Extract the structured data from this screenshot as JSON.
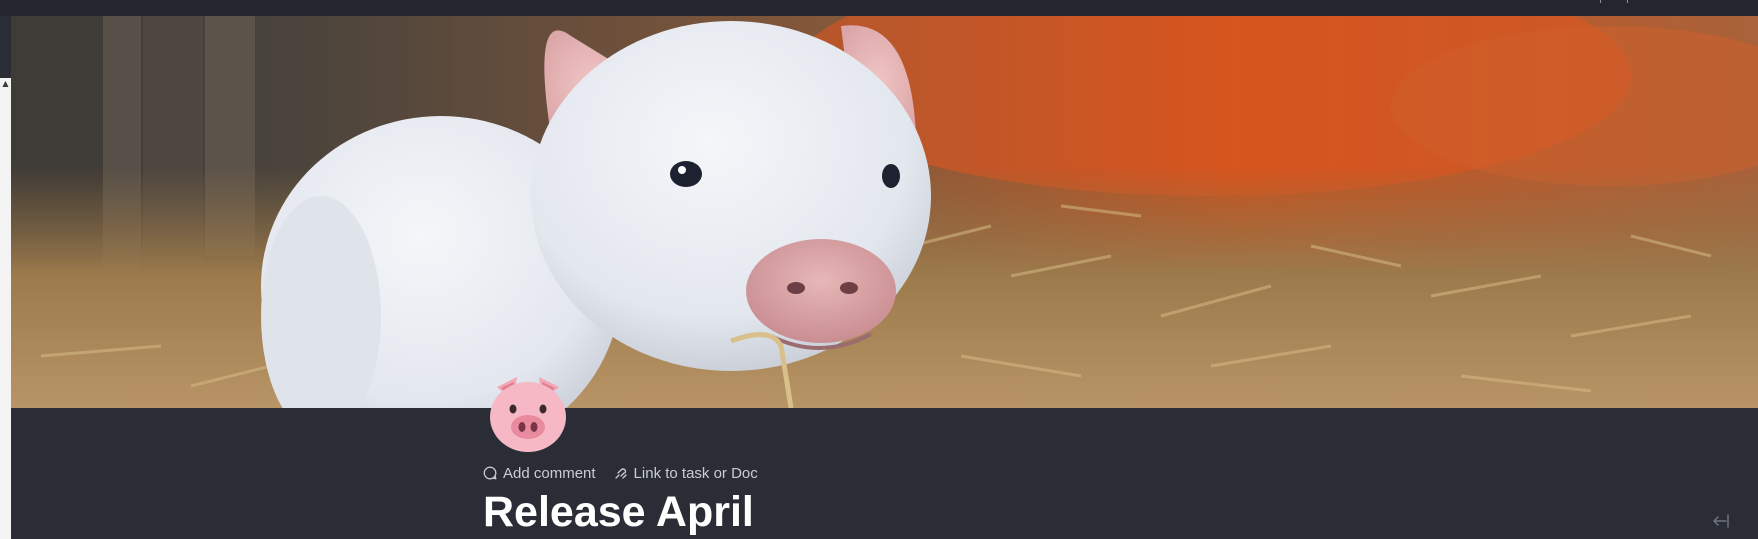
{
  "cover": {
    "image": "pig-eating-straw-photo",
    "colors": {
      "straw": "#b08a52",
      "pig": "#eceff3",
      "barn_wall": "#4b463f",
      "warm_light": "#d9532a"
    }
  },
  "doc": {
    "icon": "pig-face-emoji",
    "title": "Release April"
  },
  "actions": {
    "add_comment": "Add comment",
    "link_task": "Link to task or Doc"
  },
  "ui": {
    "collapse_icon": "arrow-left-to-bar-icon",
    "theme_bg": "#2a2d35"
  }
}
